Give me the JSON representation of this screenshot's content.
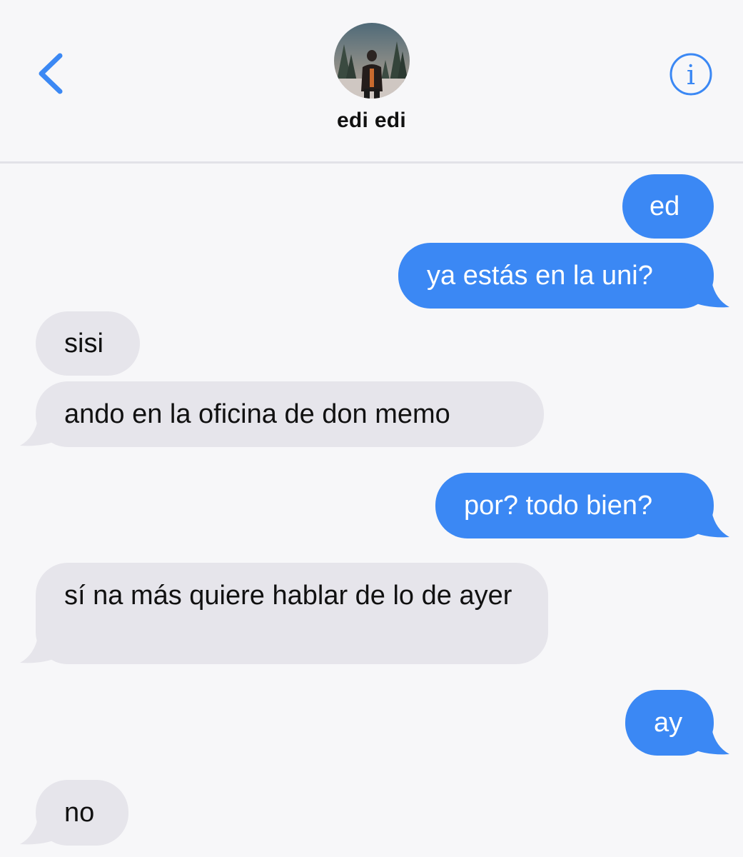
{
  "header": {
    "contact_name": "edi edi",
    "back_icon": "chevron-left-icon",
    "info_icon": "info-circle-icon",
    "info_glyph": "i",
    "accent_color": "#3b88f4"
  },
  "messages": [
    {
      "direction": "outgoing",
      "text": "ed"
    },
    {
      "direction": "outgoing",
      "text": "ya estás en la uni?"
    },
    {
      "direction": "incoming",
      "text": "sisi"
    },
    {
      "direction": "incoming",
      "text": "ando en la oficina de don memo"
    },
    {
      "direction": "outgoing",
      "text": "por? todo bien?"
    },
    {
      "direction": "incoming",
      "text": "sí na más quiere hablar de lo de ayer"
    },
    {
      "direction": "outgoing",
      "text": "ay"
    },
    {
      "direction": "incoming",
      "text": "no"
    }
  ],
  "colors": {
    "outgoing_bubble": "#3b88f4",
    "incoming_bubble": "#e6e5eb",
    "background": "#f7f7f9"
  }
}
